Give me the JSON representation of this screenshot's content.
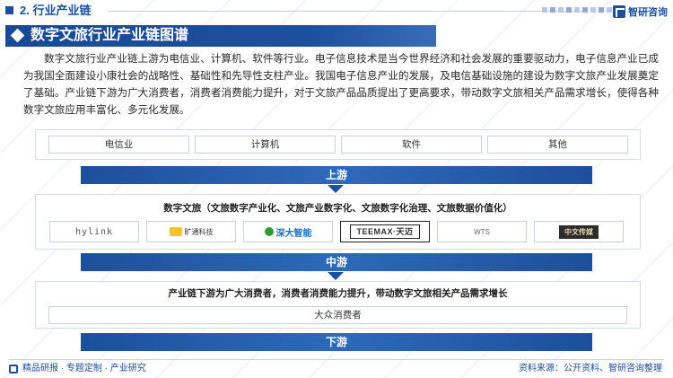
{
  "header": {
    "section_label": "2. 行业产业链",
    "brand": "智研咨询"
  },
  "title": "数字文旅行业产业链图谱",
  "intro": "数字文旅行业产业链上游为电信业、计算机、软件等行业。电子信息技术是当今世界经济和社会发展的重要驱动力，电子信息产业已成为我国全面建设小康社会的战略性、基础性和先导性支柱产业。我国电子信息产业的发展，及电信基础设施的建设为数字文旅产业发展奠定了基础。产业链下游为广大消费者，消费者消费能力提升，对于文旅产品品质提出了更高要求，带动数字文旅相关产品需求增长，使得各种数字文旅应用丰富化、多元化发展。",
  "diagram": {
    "upstream": {
      "items": [
        "电信业",
        "计算机",
        "软件",
        "其他"
      ],
      "label": "上游"
    },
    "midstream": {
      "title": "数字文旅（文旅数字产业化、文旅产业数字化、文旅数字化治理、文旅数据价值化）",
      "logos": [
        "hylink",
        "旷通科技",
        "深大智能",
        "TEEMAX·天迈",
        "WTS",
        "中文传媒"
      ],
      "label": "中游"
    },
    "downstream": {
      "description": "产业链下游为广大消费者，消费者消费能力提升，带动数字文旅相关产品需求增长",
      "consumer": "大众消费者",
      "label": "下游"
    }
  },
  "footer": {
    "left": "精品研报 · 专题定制 · 产业研究",
    "source": "资料来源：公开资料、智研咨询整理"
  },
  "colors": {
    "primary": "#1c4f9c",
    "border": "#c7d1e0"
  }
}
